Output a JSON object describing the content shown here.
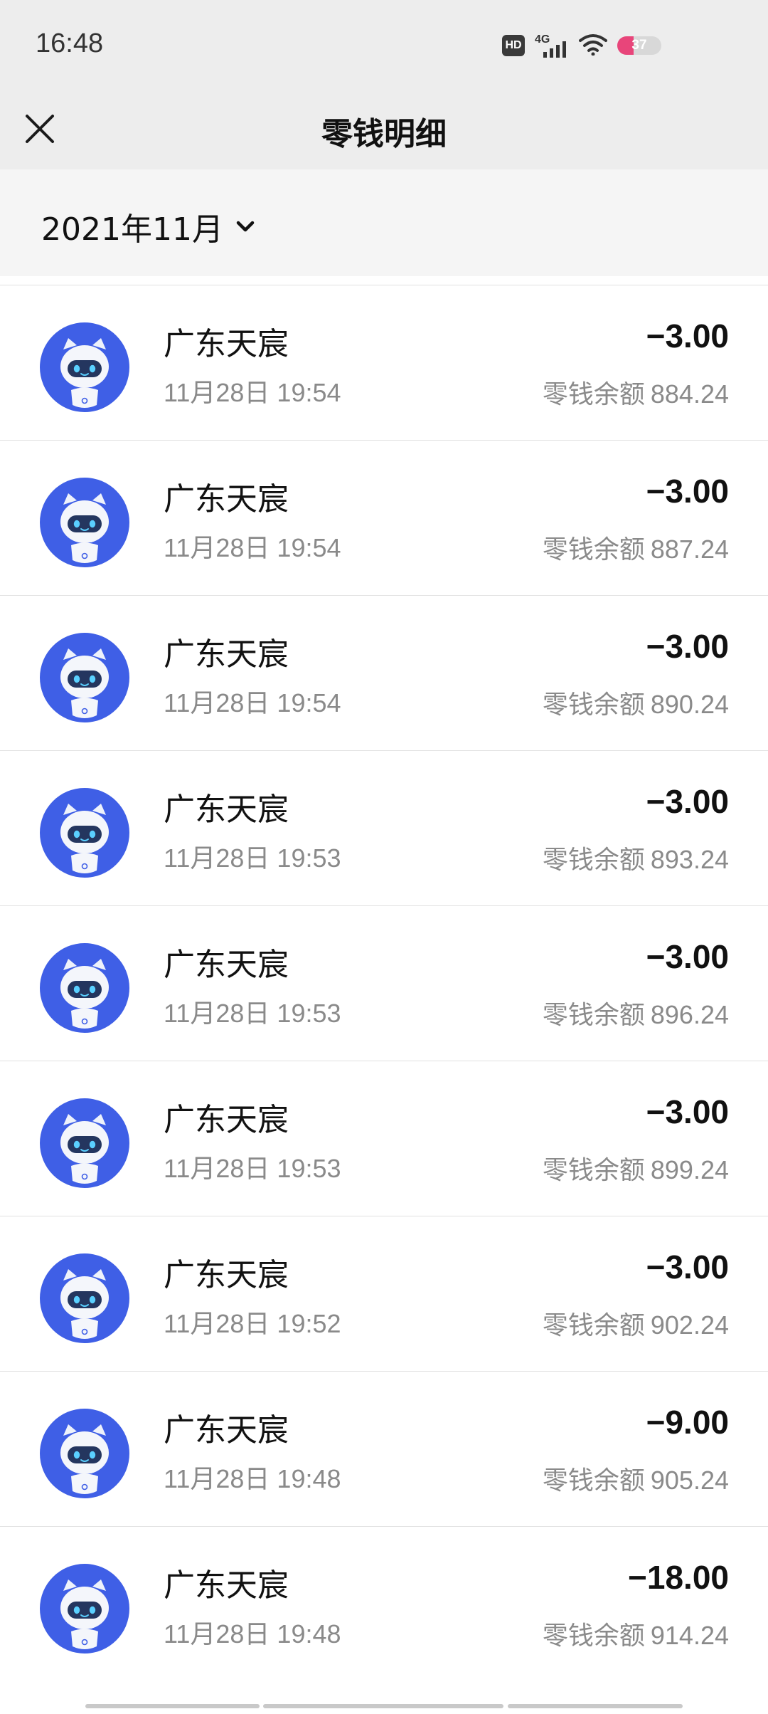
{
  "status_bar": {
    "time": "16:48",
    "hd_badge": "HD",
    "network": "4G",
    "battery": "37"
  },
  "header": {
    "title": "零钱明细",
    "close_icon": "close-icon"
  },
  "filter": {
    "month": "2021年11月",
    "dropdown_icon": "chevron-down-icon"
  },
  "transactions": [
    {
      "merchant": "广东天宸",
      "time": "11月28日 19:54",
      "amount": "−3.00",
      "balance_label": "零钱余额",
      "balance": "884.24"
    },
    {
      "merchant": "广东天宸",
      "time": "11月28日 19:54",
      "amount": "−3.00",
      "balance_label": "零钱余额",
      "balance": "887.24"
    },
    {
      "merchant": "广东天宸",
      "time": "11月28日 19:54",
      "amount": "−3.00",
      "balance_label": "零钱余额",
      "balance": "890.24"
    },
    {
      "merchant": "广东天宸",
      "time": "11月28日 19:53",
      "amount": "−3.00",
      "balance_label": "零钱余额",
      "balance": "893.24"
    },
    {
      "merchant": "广东天宸",
      "time": "11月28日 19:53",
      "amount": "−3.00",
      "balance_label": "零钱余额",
      "balance": "896.24"
    },
    {
      "merchant": "广东天宸",
      "time": "11月28日 19:53",
      "amount": "−3.00",
      "balance_label": "零钱余额",
      "balance": "899.24"
    },
    {
      "merchant": "广东天宸",
      "time": "11月28日 19:52",
      "amount": "−3.00",
      "balance_label": "零钱余额",
      "balance": "902.24"
    },
    {
      "merchant": "广东天宸",
      "time": "11月28日 19:48",
      "amount": "−9.00",
      "balance_label": "零钱余额",
      "balance": "905.24"
    },
    {
      "merchant": "广东天宸",
      "time": "11月28日 19:48",
      "amount": "−18.00",
      "balance_label": "零钱余额",
      "balance": "914.24"
    }
  ],
  "colors": {
    "avatar_blue": "#3f5fe6",
    "battery_pink": "#e8457a"
  }
}
